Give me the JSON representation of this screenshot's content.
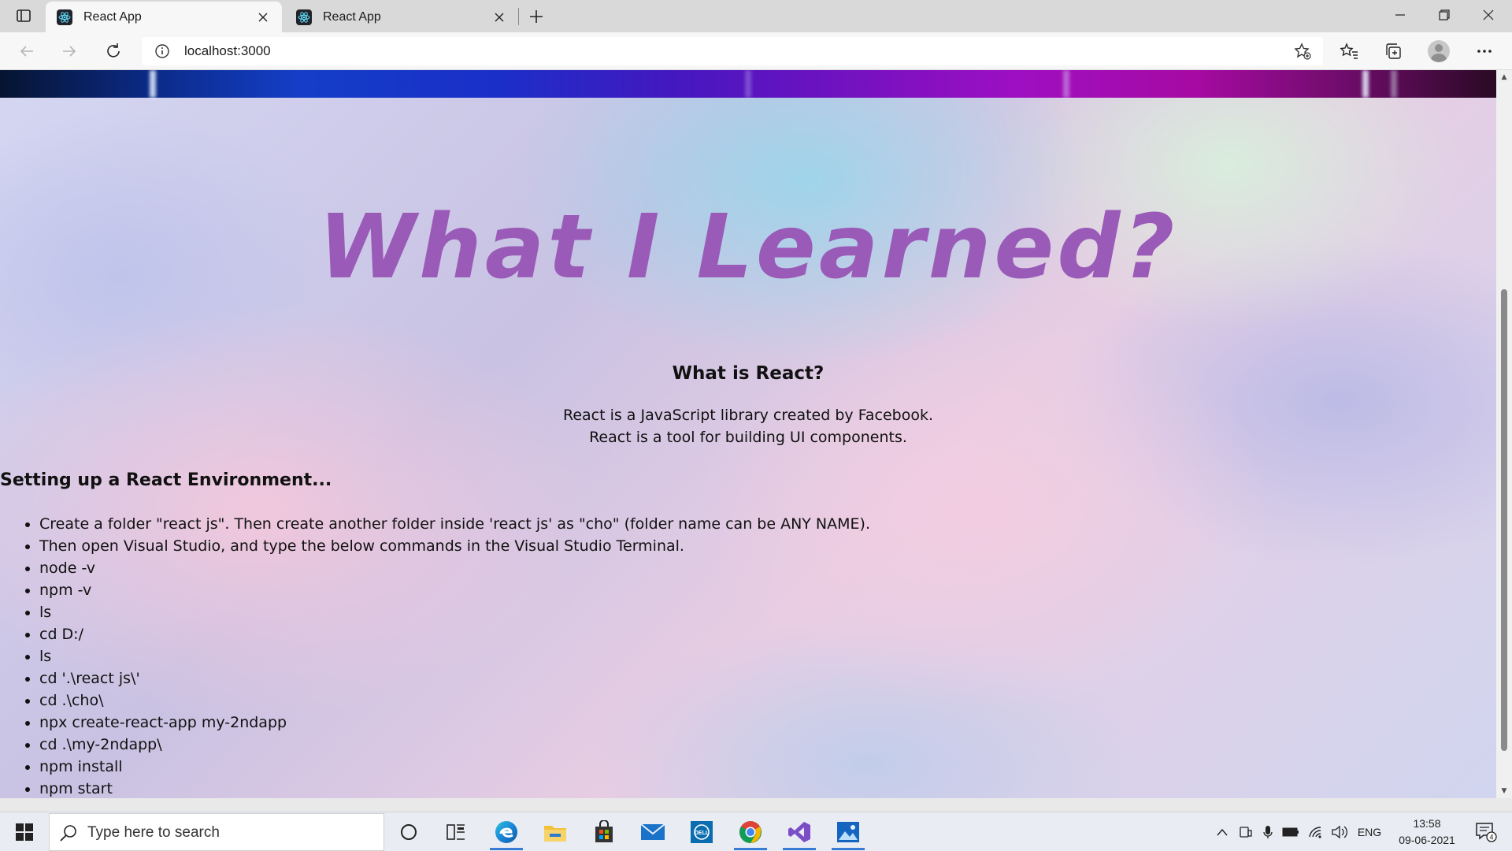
{
  "browser": {
    "tabs": [
      {
        "title": "React App",
        "active": true
      },
      {
        "title": "React App",
        "active": false
      }
    ],
    "address": "localhost:3000"
  },
  "page": {
    "hero_title": "What I Learned?",
    "subheading": "What is React?",
    "intro_lines": [
      "React is a JavaScript library created by Facebook.",
      "React is a tool for building UI components."
    ],
    "setup_heading": "Setting up a React Environment...",
    "steps": [
      "Create a folder \"react js\". Then create another folder inside 'react js' as \"cho\" (folder name can be ANY NAME).",
      "Then open Visual Studio, and type the below commands in the Visual Studio Terminal.",
      "node -v",
      "npm -v",
      "ls",
      "cd D:/",
      "ls",
      "cd '.\\react js\\'",
      "cd .\\cho\\",
      "npx create-react-app my-2ndapp",
      "cd .\\my-2ndapp\\",
      "npm install",
      "npm start"
    ],
    "colors": {
      "hero": "#9a5bb8"
    }
  },
  "taskbar": {
    "search_placeholder": "Type here to search",
    "language": "ENG",
    "time": "13:58",
    "date": "09-06-2021",
    "notification_count": "4",
    "apps": [
      "cortana-icon",
      "task-view-icon",
      "edge-icon",
      "file-explorer-icon",
      "store-icon",
      "mail-icon",
      "dell-icon",
      "chrome-icon",
      "visual-studio-icon",
      "photos-icon"
    ]
  }
}
